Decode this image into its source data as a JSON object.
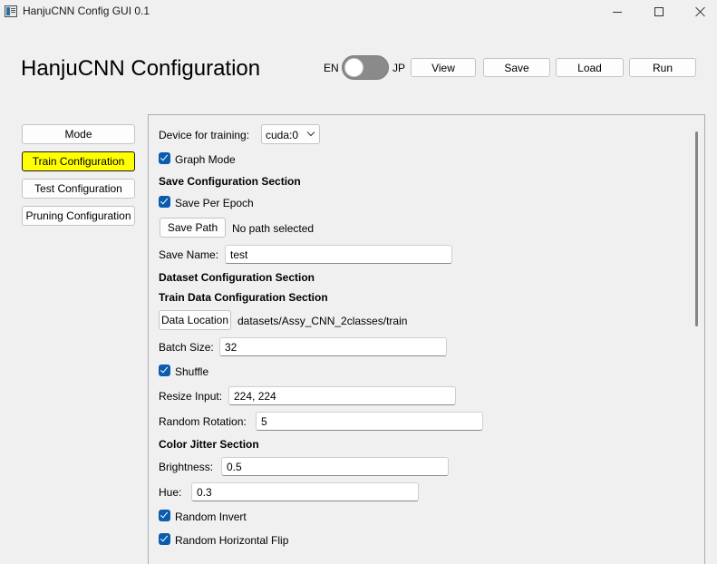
{
  "window": {
    "title": "HanjuCNN Config GUI 0.1"
  },
  "header": {
    "title": "HanjuCNN Configuration",
    "lang_left": "EN",
    "lang_right": "JP",
    "language_toggle_on": false,
    "buttons": {
      "view": "View",
      "save": "Save",
      "load": "Load",
      "run": "Run"
    }
  },
  "sidebar": {
    "items": [
      {
        "label": "Mode",
        "active": false
      },
      {
        "label": "Train Configuration",
        "active": true
      },
      {
        "label": "Test Configuration",
        "active": false
      },
      {
        "label": "Pruning Configuration",
        "active": false
      }
    ],
    "active_color": "#ffff00"
  },
  "form": {
    "device_label": "Device for training:",
    "device_value": "cuda:0",
    "graph_mode": {
      "label": "Graph Mode",
      "checked": true
    },
    "save_section_title": "Save Configuration Section",
    "save_per_epoch": {
      "label": "Save Per Epoch",
      "checked": true
    },
    "save_path_button": "Save Path",
    "save_path_value": "No path selected",
    "save_name_label": "Save Name:",
    "save_name_value": "test",
    "dataset_section_title": "Dataset Configuration Section",
    "train_data_section_title": "Train Data Configuration Section",
    "data_location_button": "Data Location",
    "data_location_value": "datasets/Assy_CNN_2classes/train",
    "batch_size_label": "Batch Size:",
    "batch_size_value": "32",
    "shuffle": {
      "label": "Shuffle",
      "checked": true
    },
    "resize_input_label": "Resize Input:",
    "resize_input_value": "224, 224",
    "random_rotation_label": "Random Rotation:",
    "random_rotation_value": "5",
    "color_jitter_section_title": "Color Jitter Section",
    "brightness_label": "Brightness:",
    "brightness_value": "0.5",
    "hue_label": "Hue:",
    "hue_value": "0.3",
    "random_invert": {
      "label": "Random Invert",
      "checked": true
    },
    "random_horizontal_flip": {
      "label": "Random Horizontal Flip",
      "checked": true
    }
  },
  "colors": {
    "accent": "#0b5cad",
    "window_bg": "#f0f0f0"
  }
}
